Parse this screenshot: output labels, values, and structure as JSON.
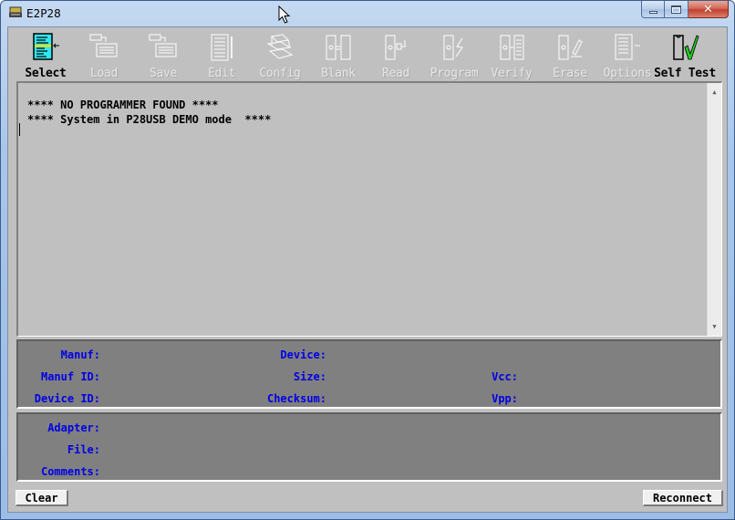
{
  "window": {
    "title": "E2P28",
    "app_icon": "programmer-device-icon",
    "controls": {
      "minimize": "minimize-icon",
      "maximize": "maximize-icon",
      "close": "close-icon"
    }
  },
  "toolbar": {
    "items": [
      {
        "id": "select",
        "label": "Select",
        "icon": "select-list-icon",
        "enabled": true
      },
      {
        "id": "load",
        "label": "Load",
        "icon": "load-file-icon",
        "enabled": false
      },
      {
        "id": "save",
        "label": "Save",
        "icon": "save-file-icon",
        "enabled": false
      },
      {
        "id": "edit",
        "label": "Edit",
        "icon": "edit-document-icon",
        "enabled": false
      },
      {
        "id": "config",
        "label": "Config",
        "icon": "config-stack-icon",
        "enabled": false
      },
      {
        "id": "blank",
        "label": "Blank",
        "icon": "blank-check-chip-icon",
        "enabled": false
      },
      {
        "id": "read",
        "label": "Read",
        "icon": "read-chip-icon",
        "enabled": false
      },
      {
        "id": "program",
        "label": "Program",
        "icon": "program-chip-icon",
        "enabled": false
      },
      {
        "id": "verify",
        "label": "Verify",
        "icon": "verify-chip-icon",
        "enabled": false
      },
      {
        "id": "erase",
        "label": "Erase",
        "icon": "erase-chip-icon",
        "enabled": false
      },
      {
        "id": "options",
        "label": "Options",
        "icon": "options-list-icon",
        "enabled": false
      },
      {
        "id": "selftest",
        "label": "Self Test",
        "icon": "self-test-check-icon",
        "enabled": true
      }
    ]
  },
  "console": {
    "lines": [
      "**** NO PROGRAMMER FOUND ****",
      "**** System in P28USB DEMO mode  ****"
    ]
  },
  "device_info": {
    "manuf_label": "Manuf:",
    "manuf_value": "",
    "device_label": "Device:",
    "device_value": "",
    "manuf_id_label": "Manuf ID:",
    "manuf_id_value": "",
    "size_label": "Size:",
    "size_value": "",
    "vcc_label": "Vcc:",
    "vcc_value": "",
    "device_id_label": "Device ID:",
    "device_id_value": "",
    "checksum_label": "Checksum:",
    "checksum_value": "",
    "vpp_label": "Vpp:",
    "vpp_value": ""
  },
  "file_info": {
    "adapter_label": "Adapter:",
    "adapter_value": "",
    "file_label": "File:",
    "file_value": "",
    "comments_label": "Comments:",
    "comments_value": ""
  },
  "buttons": {
    "clear": "Clear",
    "reconnect": "Reconnect"
  },
  "colors": {
    "label_blue": "#0000e6",
    "panel_gray": "#808080",
    "client_gray": "#c0c0c0",
    "selftest_check": "#22cc22",
    "select_icon_cyan": "#33e6f0"
  }
}
